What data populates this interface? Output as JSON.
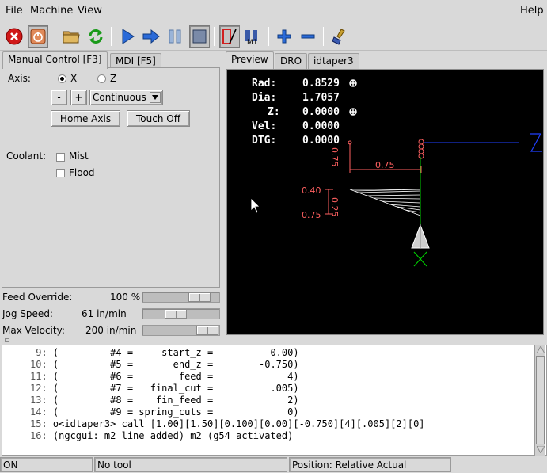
{
  "menubar": {
    "file": "File",
    "machine": "Machine",
    "view": "View",
    "help": "Help"
  },
  "toolbar": {
    "icons": [
      "estop-icon",
      "power-icon",
      "open-folder-icon",
      "reload-icon",
      "run-icon",
      "step-icon",
      "pause-icon",
      "stop-icon",
      "block-delete-icon",
      "optional-stop-icon",
      "zoom-in-icon",
      "zoom-out-icon",
      "clear-plot-icon"
    ]
  },
  "tabs_left": {
    "manual": "Manual Control [F3]",
    "mdi": "MDI [F5]"
  },
  "tabs_right": {
    "preview": "Preview",
    "dro": "DRO",
    "ngcgui": "idtaper3"
  },
  "manual": {
    "axis_label": "Axis:",
    "axis_x": "X",
    "axis_z": "Z",
    "selected_axis": "X",
    "minus": "-",
    "plus": "+",
    "jog_mode": "Continuous",
    "home_axis": "Home Axis",
    "touch_off": "Touch Off",
    "coolant_label": "Coolant:",
    "mist": "Mist",
    "flood": "Flood"
  },
  "overrides": {
    "feed_label": "Feed Override:",
    "feed_value": "100 %",
    "jog_label": "Jog Speed:",
    "jog_value": "61 in/min",
    "maxvel_label": "Max Velocity:",
    "maxvel_value": "200 in/min"
  },
  "dro": {
    "rad_label": "Rad:",
    "rad_value": "0.8529",
    "dia_label": "Dia:",
    "dia_value": "1.7057",
    "z_label": "Z:",
    "z_value": "0.0000",
    "vel_label": "Vel:",
    "vel_value": "0.0000",
    "dtg_label": "DTG:",
    "dtg_value": "0.0000"
  },
  "preview_labels": {
    "dim_075_top": "0.75",
    "dim_075_vert": "0.75",
    "dim_040": "0.40",
    "dim_025": "0.25",
    "dim_075_bottom": "0.75",
    "axis_z": "Z"
  },
  "gcode": {
    "lines": [
      {
        "n": " 9:",
        "text": " (         #4 =     start_z =          0.00)"
      },
      {
        "n": "10:",
        "text": " (         #5 =       end_z =        -0.750)"
      },
      {
        "n": "11:",
        "text": " (         #6 =        feed =             4)"
      },
      {
        "n": "12:",
        "text": " (         #7 =   final_cut =          .005)"
      },
      {
        "n": "13:",
        "text": " (         #8 =    fin_feed =             2)"
      },
      {
        "n": "14:",
        "text": " (         #9 = spring_cuts =             0)"
      },
      {
        "n": "15:",
        "text": " o<idtaper3> call [1.00][1.50][0.100][0.00][-0.750][4][.005][2][0]"
      },
      {
        "n": "16:",
        "text": " (ngcgui: m2 line added) m2 (g54 activated)"
      }
    ]
  },
  "statusbar": {
    "state": "ON",
    "tool": "No tool",
    "position": "Position: Relative Actual"
  },
  "colors": {
    "background": "#d9d9d9",
    "preview_bg": "#000000",
    "dim_color": "#ff6060",
    "tool_path_green": "#00cc00",
    "axis_blue": "#2040ff"
  }
}
